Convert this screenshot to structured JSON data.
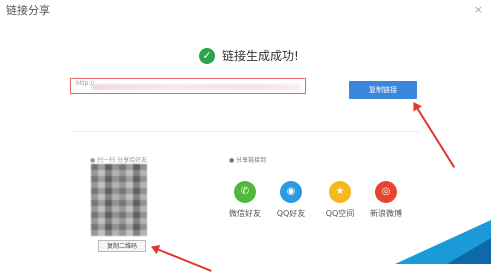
{
  "window": {
    "title": "链接分享",
    "close_glyph": "×"
  },
  "success": {
    "icon": "check-circle-icon",
    "message": "链接生成成功!"
  },
  "link": {
    "value": "http://",
    "copy_button": "复制链接"
  },
  "qr": {
    "label_prefix": "● 扫一扫",
    "label_suffix": "分享给好友",
    "copy_button": "复制二维码"
  },
  "share": {
    "label": "● 分享链接到",
    "items": [
      {
        "name": "微信好友",
        "icon": "wechat-icon",
        "color": "#4fb83d",
        "glyph": "✆"
      },
      {
        "name": "QQ好友",
        "icon": "qq-icon",
        "color": "#2c9ae0",
        "glyph": "◉"
      },
      {
        "name": "QQ空间",
        "icon": "qzone-icon",
        "color": "#f6b81b",
        "glyph": "★"
      },
      {
        "name": "新浪微博",
        "icon": "weibo-icon",
        "color": "#e5462f",
        "glyph": "◎"
      }
    ]
  },
  "colors": {
    "accent": "#3b86dd",
    "success": "#2ea24a",
    "annotation": "#e03a2e"
  }
}
